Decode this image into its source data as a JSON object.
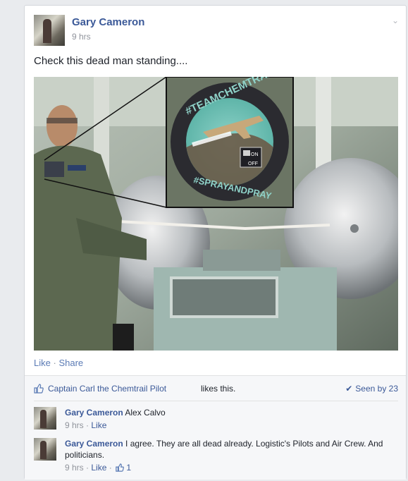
{
  "post": {
    "author": "Gary Cameron",
    "time": "9 hrs",
    "text": "Check this dead man standing....",
    "photo": {
      "patch_top_text": "#TEAMCHEMTRAIL",
      "patch_bottom_text": "#SPRAYANDPRAY",
      "patch_switch_on": "ON",
      "patch_switch_off": "OFF"
    },
    "actions": {
      "like": "Like",
      "separator": "·",
      "share": "Share"
    }
  },
  "feedback": {
    "liker": "Captain Carl the Chemtrail Pilot",
    "likes_suffix": "likes this.",
    "seen_by": "Seen by 23"
  },
  "comments": [
    {
      "author": "Gary Cameron",
      "text": "Alex Calvo",
      "time": "9 hrs",
      "like_label": "Like"
    },
    {
      "author": "Gary Cameron",
      "text": "I agree. They are all dead already. Logistic's Pilots and Air Crew. And politicians.",
      "time": "9 hrs",
      "like_label": "Like",
      "like_count": "1"
    }
  ],
  "colors": {
    "link": "#3b5998",
    "meta": "#90949c",
    "background": "#e9ebee"
  },
  "icons": [
    "chevron-down-icon",
    "thumbs-up-icon",
    "checkmark-icon",
    "like-count-icon"
  ]
}
